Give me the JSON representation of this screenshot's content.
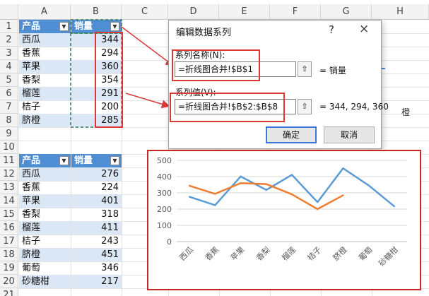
{
  "sheet": {
    "columns": [
      "A",
      "B",
      "C",
      "D",
      "E",
      "F",
      "G",
      "H"
    ],
    "rows": [
      "1",
      "2",
      "3",
      "4",
      "5",
      "6",
      "7",
      "8",
      "9",
      "10",
      "11",
      "12",
      "13",
      "14",
      "15",
      "16",
      "17",
      "18",
      "19",
      "20",
      "21"
    ]
  },
  "table1": {
    "header_product": "产品",
    "header_sales": "销量",
    "dropdown_glyph": "▼",
    "rows": [
      {
        "product": "西瓜",
        "sales": "344"
      },
      {
        "product": "香蕉",
        "sales": "294"
      },
      {
        "product": "苹果",
        "sales": "360"
      },
      {
        "product": "香梨",
        "sales": "354"
      },
      {
        "product": "榴莲",
        "sales": "291"
      },
      {
        "product": "桔子",
        "sales": "200"
      },
      {
        "product": "脐橙",
        "sales": "285"
      }
    ]
  },
  "table2": {
    "header_product": "产品",
    "header_sales": "销量",
    "dropdown_glyph": "▼",
    "rows": [
      {
        "product": "西瓜",
        "sales": "276"
      },
      {
        "product": "香蕉",
        "sales": "224"
      },
      {
        "product": "苹果",
        "sales": "401"
      },
      {
        "product": "香梨",
        "sales": "318"
      },
      {
        "product": "榴莲",
        "sales": "411"
      },
      {
        "product": "桔子",
        "sales": "243"
      },
      {
        "product": "脐橙",
        "sales": "451"
      },
      {
        "product": "葡萄",
        "sales": "346"
      },
      {
        "product": "砂糖柑",
        "sales": "217"
      }
    ]
  },
  "dialog": {
    "title": "编辑数据系列",
    "help": "?",
    "close": "×",
    "series_name_label": "系列名称(N):",
    "series_name_value": "=折线图合并!$B$1",
    "series_name_result": "=  销量",
    "series_values_label": "系列值(V):",
    "series_values_value": "=折线图合并!$B$2:$B$8",
    "series_values_result": "=  344, 294, 360",
    "ok_label": "确定",
    "cancel_label": "取消",
    "collapse_glyph": "⇧"
  },
  "behind_dialog_text": "橙",
  "chart_data": {
    "type": "line",
    "categories": [
      "西瓜",
      "香蕉",
      "苹果",
      "香梨",
      "榴莲",
      "桔子",
      "脐橙",
      "葡萄",
      "砂糖柑"
    ],
    "yticks": [
      "0",
      "100",
      "200",
      "300",
      "400",
      "500"
    ],
    "ylim": [
      0,
      500
    ],
    "grid": true,
    "series": [
      {
        "color": "#5b9bd5",
        "values": [
          276,
          224,
          401,
          318,
          411,
          243,
          451,
          346,
          217
        ]
      },
      {
        "color": "#ed7d31",
        "values": [
          344,
          294,
          360,
          354,
          291,
          200,
          285
        ]
      }
    ]
  },
  "colors": {
    "table_header": "#4f8ed3",
    "band": "#dce7f5",
    "annotation_red": "#d83a3a",
    "dashed_green": "#2e7d5b"
  }
}
